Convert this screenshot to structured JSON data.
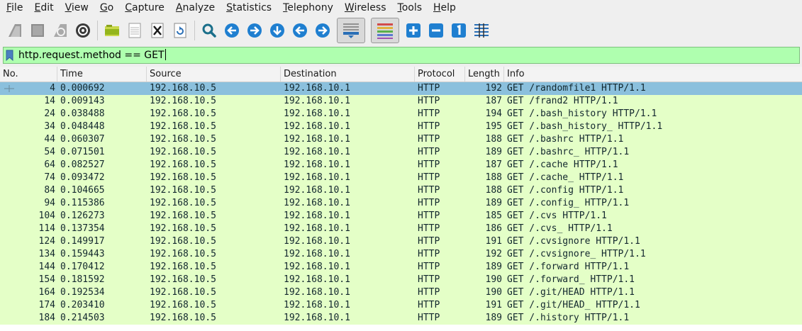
{
  "menu": [
    "File",
    "Edit",
    "View",
    "Go",
    "Capture",
    "Analyze",
    "Statistics",
    "Telephony",
    "Wireless",
    "Tools",
    "Help"
  ],
  "menu_mnemonic_index": [
    0,
    0,
    0,
    0,
    0,
    0,
    0,
    0,
    0,
    0,
    0
  ],
  "toolbar": {
    "icons": [
      "start-capture-icon",
      "stop-capture-icon",
      "restart-capture-icon",
      "capture-options-icon",
      "open-file-icon",
      "save-file-icon",
      "close-file-icon",
      "reload-file-icon",
      "find-packet-icon",
      "go-back-icon",
      "go-forward-icon",
      "go-to-packet-icon",
      "go-first-icon",
      "go-last-icon",
      "autoscroll-icon",
      "colorize-icon",
      "zoom-in-icon",
      "zoom-out-icon",
      "normal-size-icon",
      "resize-columns-icon"
    ]
  },
  "filter": {
    "value": "http.request.method == GET"
  },
  "colors": {
    "row_bg": "#e4ffc7",
    "selected_bg": "#8bc0dd",
    "filter_bg": "#afffaf"
  },
  "columns": [
    "No.",
    "Time",
    "Source",
    "Destination",
    "Protocol",
    "Length",
    "Info"
  ],
  "rows": [
    {
      "no": "4",
      "time": "0.000692",
      "src": "192.168.10.5",
      "dst": "192.168.10.1",
      "proto": "HTTP",
      "len": "192",
      "info": "GET /randomfile1 HTTP/1.1",
      "selected": true
    },
    {
      "no": "14",
      "time": "0.009143",
      "src": "192.168.10.5",
      "dst": "192.168.10.1",
      "proto": "HTTP",
      "len": "187",
      "info": "GET /frand2 HTTP/1.1"
    },
    {
      "no": "24",
      "time": "0.038488",
      "src": "192.168.10.5",
      "dst": "192.168.10.1",
      "proto": "HTTP",
      "len": "194",
      "info": "GET /.bash_history HTTP/1.1"
    },
    {
      "no": "34",
      "time": "0.048448",
      "src": "192.168.10.5",
      "dst": "192.168.10.1",
      "proto": "HTTP",
      "len": "195",
      "info": "GET /.bash_history_ HTTP/1.1"
    },
    {
      "no": "44",
      "time": "0.060307",
      "src": "192.168.10.5",
      "dst": "192.168.10.1",
      "proto": "HTTP",
      "len": "188",
      "info": "GET /.bashrc HTTP/1.1"
    },
    {
      "no": "54",
      "time": "0.071501",
      "src": "192.168.10.5",
      "dst": "192.168.10.1",
      "proto": "HTTP",
      "len": "189",
      "info": "GET /.bashrc_ HTTP/1.1"
    },
    {
      "no": "64",
      "time": "0.082527",
      "src": "192.168.10.5",
      "dst": "192.168.10.1",
      "proto": "HTTP",
      "len": "187",
      "info": "GET /.cache HTTP/1.1"
    },
    {
      "no": "74",
      "time": "0.093472",
      "src": "192.168.10.5",
      "dst": "192.168.10.1",
      "proto": "HTTP",
      "len": "188",
      "info": "GET /.cache_ HTTP/1.1"
    },
    {
      "no": "84",
      "time": "0.104665",
      "src": "192.168.10.5",
      "dst": "192.168.10.1",
      "proto": "HTTP",
      "len": "188",
      "info": "GET /.config HTTP/1.1"
    },
    {
      "no": "94",
      "time": "0.115386",
      "src": "192.168.10.5",
      "dst": "192.168.10.1",
      "proto": "HTTP",
      "len": "189",
      "info": "GET /.config_ HTTP/1.1"
    },
    {
      "no": "104",
      "time": "0.126273",
      "src": "192.168.10.5",
      "dst": "192.168.10.1",
      "proto": "HTTP",
      "len": "185",
      "info": "GET /.cvs HTTP/1.1"
    },
    {
      "no": "114",
      "time": "0.137354",
      "src": "192.168.10.5",
      "dst": "192.168.10.1",
      "proto": "HTTP",
      "len": "186",
      "info": "GET /.cvs_ HTTP/1.1"
    },
    {
      "no": "124",
      "time": "0.149917",
      "src": "192.168.10.5",
      "dst": "192.168.10.1",
      "proto": "HTTP",
      "len": "191",
      "info": "GET /.cvsignore HTTP/1.1"
    },
    {
      "no": "134",
      "time": "0.159443",
      "src": "192.168.10.5",
      "dst": "192.168.10.1",
      "proto": "HTTP",
      "len": "192",
      "info": "GET /.cvsignore_ HTTP/1.1"
    },
    {
      "no": "144",
      "time": "0.170412",
      "src": "192.168.10.5",
      "dst": "192.168.10.1",
      "proto": "HTTP",
      "len": "189",
      "info": "GET /.forward HTTP/1.1"
    },
    {
      "no": "154",
      "time": "0.181592",
      "src": "192.168.10.5",
      "dst": "192.168.10.1",
      "proto": "HTTP",
      "len": "190",
      "info": "GET /.forward_ HTTP/1.1"
    },
    {
      "no": "164",
      "time": "0.192534",
      "src": "192.168.10.5",
      "dst": "192.168.10.1",
      "proto": "HTTP",
      "len": "190",
      "info": "GET /.git/HEAD HTTP/1.1"
    },
    {
      "no": "174",
      "time": "0.203410",
      "src": "192.168.10.5",
      "dst": "192.168.10.1",
      "proto": "HTTP",
      "len": "191",
      "info": "GET /.git/HEAD_ HTTP/1.1"
    },
    {
      "no": "184",
      "time": "0.214503",
      "src": "192.168.10.5",
      "dst": "192.168.10.1",
      "proto": "HTTP",
      "len": "189",
      "info": "GET /.history HTTP/1.1"
    }
  ]
}
